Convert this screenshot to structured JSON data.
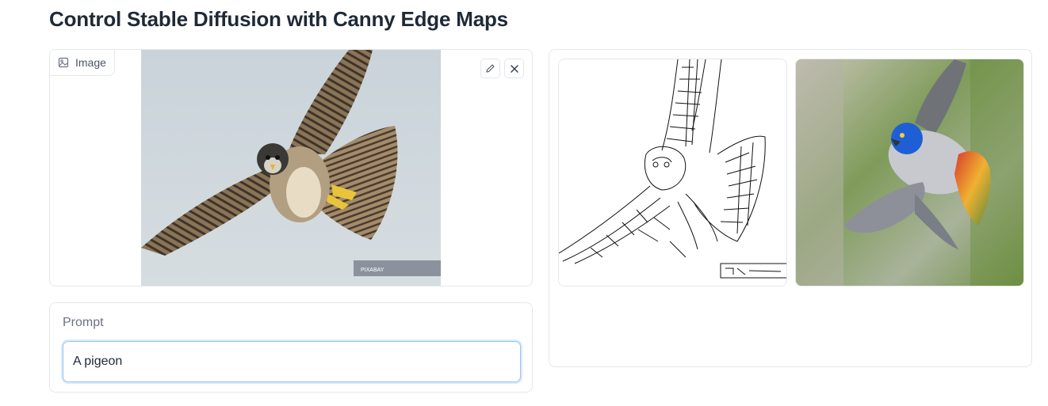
{
  "page": {
    "title": "Control Stable Diffusion with Canny Edge Maps"
  },
  "image_input": {
    "label": "Image",
    "label_icon": "image-icon",
    "edit_icon": "pencil-icon",
    "clear_icon": "close-icon",
    "watermark": "PIXABAY"
  },
  "prompt": {
    "label": "Prompt",
    "value": "A pigeon"
  },
  "gallery": {
    "items": [
      {
        "description_icon": "canny-edge-map-image"
      },
      {
        "description_icon": "generated-pigeon-image"
      }
    ]
  },
  "colors": {
    "input_focus_border": "#93c5fd",
    "panel_border": "#e5e7eb",
    "title_text": "#1f2937"
  }
}
